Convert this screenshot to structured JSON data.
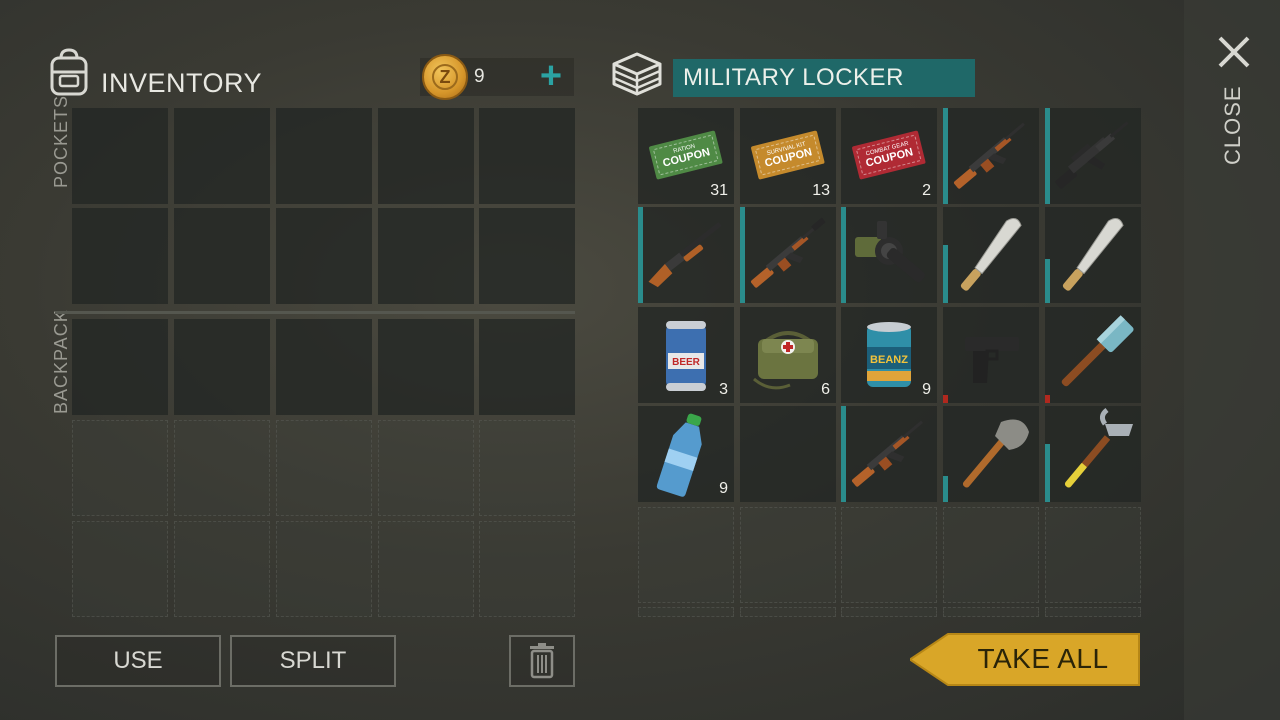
{
  "inventory": {
    "title": "INVENTORY",
    "coins": "9",
    "plus": "+",
    "pockets_label": "POCKETS",
    "backpack_label": "BACKPACK"
  },
  "buttons": {
    "use": "USE",
    "split": "SPLIT"
  },
  "locker": {
    "title": "MILITARY LOCKER",
    "take_all": "TAKE ALL",
    "items": [
      {
        "name": "ration-coupon",
        "label_top": "RATION",
        "label_main": "COUPON",
        "qty": "31",
        "color": "#4f8a45"
      },
      {
        "name": "survival-kit-coupon",
        "label_top": "SURVIVAL KIT",
        "label_main": "COUPON",
        "qty": "13",
        "color": "#c58a2c"
      },
      {
        "name": "combat-gear-coupon",
        "label_top": "COMBAT GEAR",
        "label_main": "COUPON",
        "qty": "2",
        "color": "#b02a34"
      },
      {
        "name": "ak-rifle",
        "qty": ""
      },
      {
        "name": "m16-rifle",
        "qty": ""
      },
      {
        "name": "pump-shotgun",
        "qty": ""
      },
      {
        "name": "ak-suppressed",
        "qty": ""
      },
      {
        "name": "grenade-launcher",
        "qty": ""
      },
      {
        "name": "machete",
        "qty": ""
      },
      {
        "name": "machete",
        "qty": ""
      },
      {
        "name": "beer-can",
        "label_main": "BEER",
        "qty": "3"
      },
      {
        "name": "first-aid-bag",
        "qty": "6"
      },
      {
        "name": "beans-can",
        "label_main": "BEANZ",
        "qty": "9"
      },
      {
        "name": "pistol",
        "qty": ""
      },
      {
        "name": "sledgehammer",
        "qty": ""
      },
      {
        "name": "water-bottle",
        "qty": "9"
      },
      {
        "name": "empty",
        "qty": ""
      },
      {
        "name": "ak-rifle",
        "qty": ""
      },
      {
        "name": "shovel",
        "qty": ""
      },
      {
        "name": "hammer",
        "qty": ""
      }
    ]
  },
  "close_label": "CLOSE",
  "colors": {
    "accent_teal": "#1f6868",
    "plus_teal": "#2ba3a3",
    "take_all_gold": "#d9a628",
    "durability_red": "#b0281e"
  }
}
